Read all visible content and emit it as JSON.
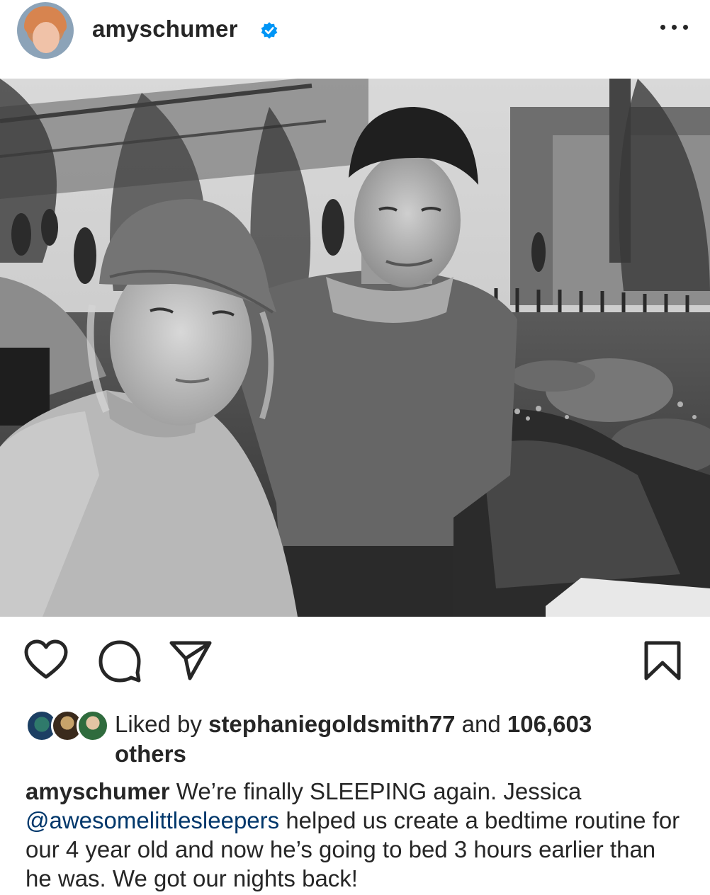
{
  "post": {
    "username": "amyschumer",
    "verified": true,
    "more_icon": "more-horizontal-icon"
  },
  "actions": {
    "like_icon": "heart-icon",
    "comment_icon": "comment-icon",
    "share_icon": "send-icon",
    "save_icon": "bookmark-icon"
  },
  "likes": {
    "prefix": "Liked by ",
    "user": "stephaniegoldsmith77",
    "middle": " and ",
    "count": "106,603",
    "suffix": "others"
  },
  "caption": {
    "author": "amyschumer",
    "text_1": " We’re finally SLEEPING again. Jessica ",
    "mention": "@awesomelittlesleepers",
    "text_2": " helped us create a bedtime routine for our 4 year old and now he’s going to bed 3 hours earlier than he was. We got our nights back!"
  },
  "colors": {
    "text": "#262626",
    "verified_blue": "#0095f6",
    "mention_blue": "#00376b",
    "background": "#ffffff"
  }
}
